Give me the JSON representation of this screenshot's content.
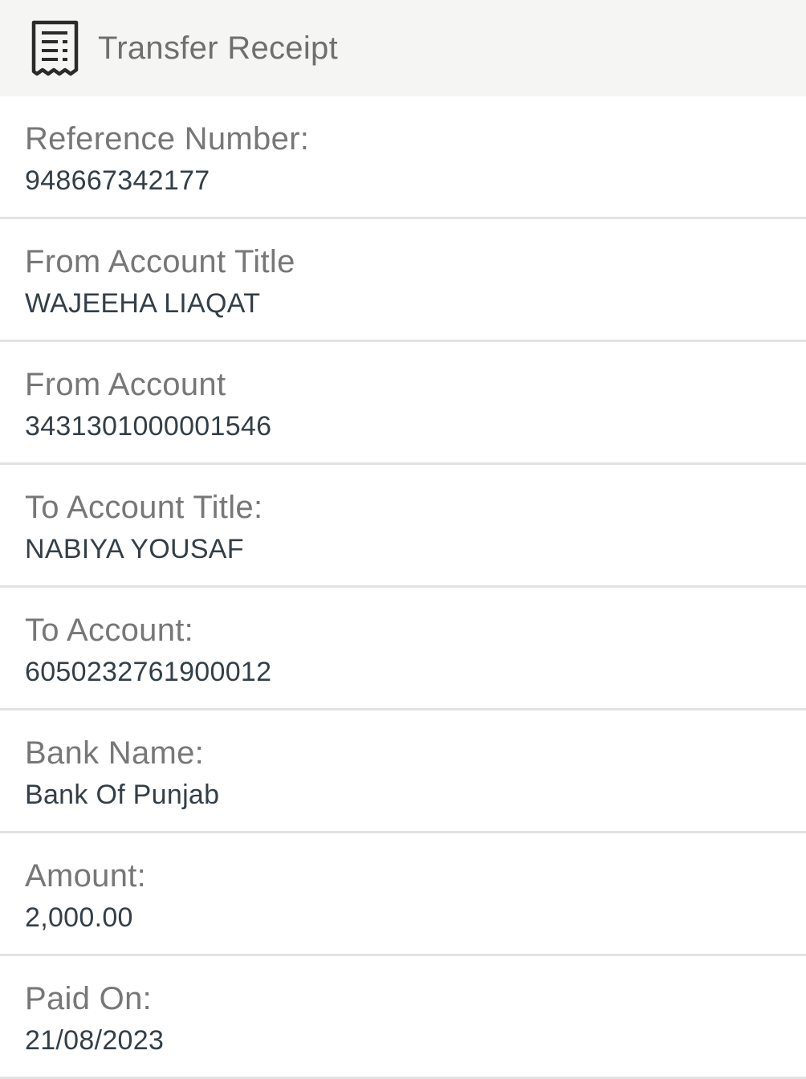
{
  "header": {
    "title": "Transfer Receipt",
    "icon": "receipt-icon"
  },
  "fields": [
    {
      "label": "Reference Number:",
      "value": "948667342177"
    },
    {
      "label": "From Account Title",
      "value": "WAJEEHA LIAQAT"
    },
    {
      "label": "From Account",
      "value": "3431301000001546"
    },
    {
      "label": "To Account Title:",
      "value": "NABIYA YOUSAF"
    },
    {
      "label": "To Account:",
      "value": "6050232761900012"
    },
    {
      "label": "Bank Name:",
      "value": "Bank Of Punjab"
    },
    {
      "label": "Amount:",
      "value": "2,000.00"
    },
    {
      "label": "Paid On:",
      "value": "21/08/2023"
    }
  ],
  "colors": {
    "header_bg": "#f5f5f4",
    "label": "#777777",
    "value": "#333f48",
    "divider": "#e2e2e2"
  }
}
